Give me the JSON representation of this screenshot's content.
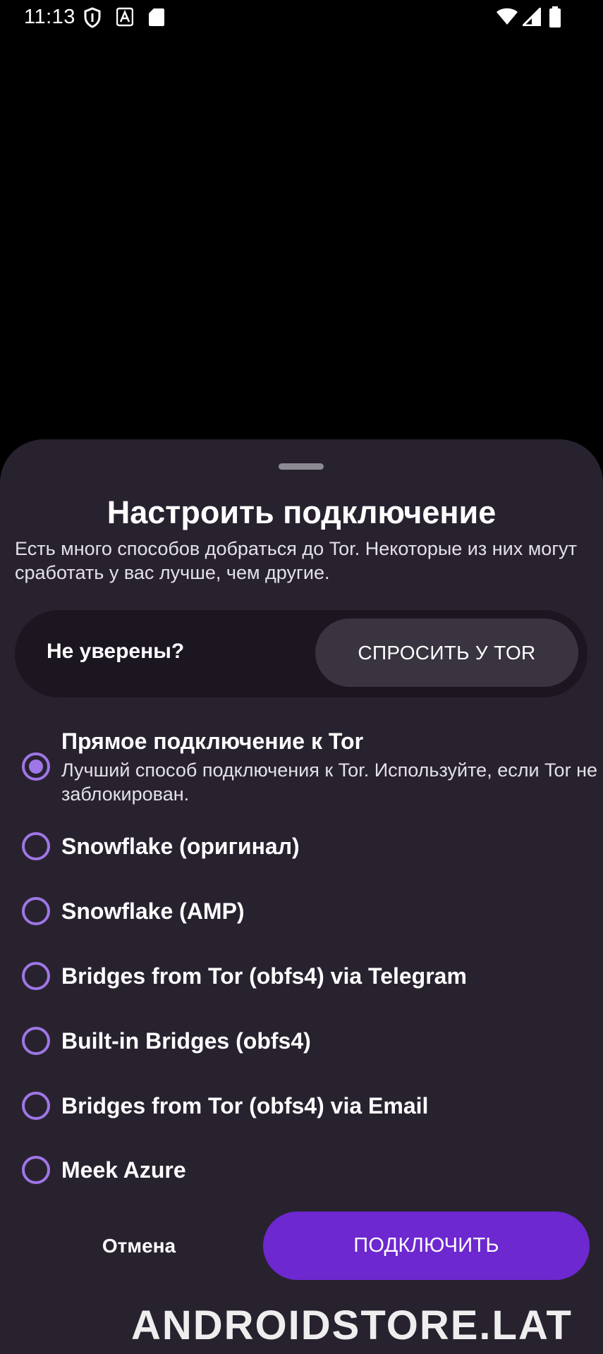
{
  "status_bar": {
    "time": "11:13",
    "icons_left": [
      "shield-icon",
      "text-a-icon",
      "sd-card-icon"
    ],
    "icons_right": [
      "wifi-icon",
      "signal-icon",
      "battery-icon"
    ]
  },
  "sheet": {
    "title": "Настроить подключение",
    "description": "Есть много способов добраться до Tor. Некоторые из них могут сработать у вас лучше, чем другие.",
    "ask": {
      "label": "Не уверены?",
      "button": "СПРОСИТЬ У TOR"
    },
    "options": [
      {
        "title": "Прямое подключение к Tor",
        "description": "Лучший способ подключения к Tor. Используйте, если Tor не заблокирован.",
        "selected": true
      },
      {
        "title": "Snowflake (оригинал)",
        "selected": false
      },
      {
        "title": "Snowflake (AMP)",
        "selected": false
      },
      {
        "title": "Bridges from Tor (obfs4) via Telegram",
        "selected": false
      },
      {
        "title": "Built-in Bridges (obfs4)",
        "selected": false
      },
      {
        "title": "Bridges from Tor (obfs4) via Email",
        "selected": false
      },
      {
        "title": "Meek Azure",
        "selected": false
      }
    ],
    "cancel": "Отмена",
    "connect": "ПОДКЛЮЧИТЬ"
  },
  "watermark": "ANDROIDSTORE.LAT",
  "colors": {
    "sheet_bg": "#28222f",
    "accent": "#6d28d0",
    "radio": "#9f76e6"
  }
}
